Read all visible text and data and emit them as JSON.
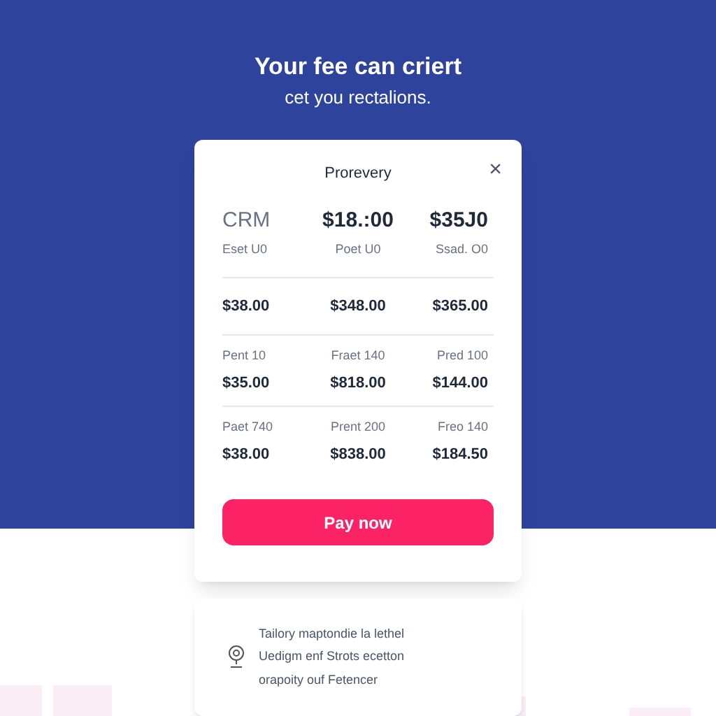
{
  "hero": {
    "title": "Your fee can criert",
    "subtitle": "cet you rectalions."
  },
  "dialog": {
    "title": "Prorevery",
    "close": "×",
    "rows": [
      {
        "kind": "header",
        "cells": [
          {
            "main": "CRM",
            "sub": "Eset U0"
          },
          {
            "main": "$18.:00",
            "sub": "Poet U0"
          },
          {
            "main": "$35J0",
            "sub": "Ssad. O0"
          }
        ]
      },
      {
        "kind": "price",
        "cells": [
          {
            "value": "$38.00"
          },
          {
            "value": "$348.00"
          },
          {
            "value": "$365.00"
          }
        ]
      },
      {
        "kind": "detail",
        "cells": [
          {
            "label": "Pent 10",
            "value": "$35.00"
          },
          {
            "label": "Fraet 140",
            "value": "$818.00"
          },
          {
            "label": "Pred 100",
            "value": "$144.00"
          }
        ]
      },
      {
        "kind": "detail",
        "cells": [
          {
            "label": "Paet 740",
            "value": "$38.00"
          },
          {
            "label": "Prent 200",
            "value": "$838.00"
          },
          {
            "label": "Freo 140",
            "value": "$184.50"
          }
        ]
      }
    ],
    "button": "Pay now"
  },
  "info": {
    "lines": [
      "Tailory maptondie la lethel",
      "Uedigm enf Strots ecetton",
      "orapoity ouf Fetencer"
    ]
  }
}
